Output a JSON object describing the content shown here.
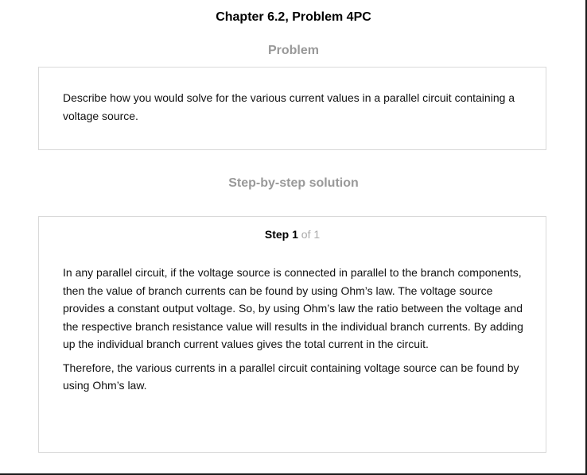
{
  "header": {
    "title": "Chapter 6.2, Problem 4PC"
  },
  "problem": {
    "heading": "Problem",
    "text": "Describe how you would solve for the various current values in a parallel circuit containing a voltage source."
  },
  "solution": {
    "heading": "Step-by-step solution",
    "step": {
      "label": "Step",
      "number": "1",
      "of_label": "of 1"
    },
    "paragraphs": [
      "In any parallel circuit, if the voltage source is connected in parallel to the branch components, then the value of branch currents can be found by using Ohm’s law. The voltage source provides a constant output voltage. So, by using Ohm’s law the ratio between the voltage and the respective branch resistance value will results in the individual branch currents. By adding up the individual branch current values gives the total current in the circuit.",
      "Therefore, the various currents in a parallel circuit containing voltage source can be found by using Ohm’s law."
    ]
  }
}
